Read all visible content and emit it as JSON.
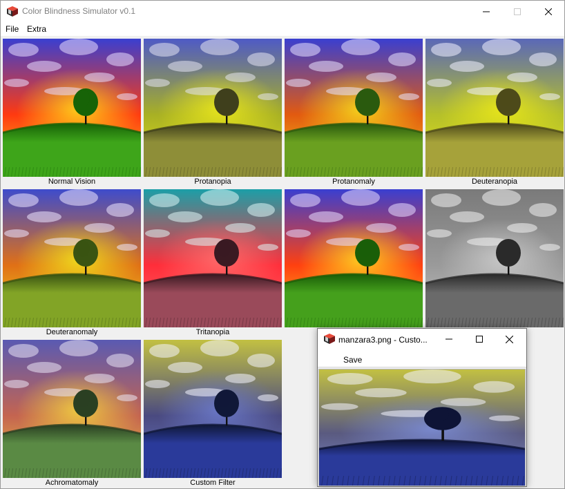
{
  "window": {
    "title": "Color Blindness Simulator v0.1",
    "icon": "app-cube-icon"
  },
  "menu": {
    "file": "File",
    "extra": "Extra"
  },
  "tiles": [
    {
      "label": "Normal Vision",
      "sky_top": "#3a3fd0",
      "sky_mid": "#ff3a10",
      "horizon": "#ffd21a",
      "grass": "#3ea51a",
      "grass_dark": "#176307",
      "cloud": "#e8ddff"
    },
    {
      "label": "Protanopia",
      "sky_top": "#4e5ac6",
      "sky_mid": "#a8b024",
      "horizon": "#e8e51c",
      "grass": "#8e8e38",
      "grass_dark": "#3f3f1c",
      "cloud": "#e4e4f0"
    },
    {
      "label": "Protanomaly",
      "sky_top": "#3a3fd0",
      "sky_mid": "#e25a10",
      "horizon": "#f5d51c",
      "grass": "#6aa020",
      "grass_dark": "#2a5a0e",
      "cloud": "#e8e2ff"
    },
    {
      "label": "Deuteranopia",
      "sky_top": "#5a68b8",
      "sky_mid": "#b5c02a",
      "horizon": "#e8e61a",
      "grass": "#a6a23a",
      "grass_dark": "#4d4a1a",
      "cloud": "#f0f0ff"
    },
    {
      "label": "Deuteranomaly",
      "sky_top": "#3e4ccc",
      "sky_mid": "#e07016",
      "horizon": "#f0dc1c",
      "grass": "#82a426",
      "grass_dark": "#3a5412",
      "cloud": "#ece6ff"
    },
    {
      "label": "Tritanopia",
      "sky_top": "#1c9fa8",
      "sky_mid": "#ff2e3a",
      "horizon": "#ff6a6a",
      "grass": "#9a4a5a",
      "grass_dark": "#3a1a22",
      "cloud": "#ddf5f5"
    },
    {
      "label": "",
      "sky_top": "#3a3fd0",
      "sky_mid": "#ff4010",
      "horizon": "#ffcf20",
      "grass": "#45a01c",
      "grass_dark": "#1a5e08",
      "cloud": "#e8ddff"
    },
    {
      "label": "",
      "sky_top": "#7a7a7a",
      "sky_mid": "#9a9a9a",
      "horizon": "#c8c8c8",
      "grass": "#6a6a6a",
      "grass_dark": "#2a2a2a",
      "cloud": "#f2f2f2"
    },
    {
      "label": "Achromatomaly",
      "sky_top": "#5a5ab2",
      "sky_mid": "#c46450",
      "horizon": "#f0cc40",
      "grass": "#5a8a44",
      "grass_dark": "#2a4022",
      "cloud": "#eae4f4"
    },
    {
      "label": "Custom Filter",
      "sky_top": "#c2c042",
      "sky_mid": "#4a4a80",
      "horizon": "#6a78c8",
      "grass": "#2a3a9a",
      "grass_dark": "#101838",
      "cloud": "#f4f4ff"
    }
  ],
  "custom_window": {
    "title": "manzara3.png - Custo...",
    "save": "Save",
    "image": {
      "sky_top": "#c2c042",
      "sky_mid": "#5a5a80",
      "horizon": "#7a8ad0",
      "grass": "#2a3a9a",
      "grass_dark": "#0e1436",
      "cloud": "#f4f4ff"
    }
  },
  "icons": [
    "minimize-icon",
    "maximize-icon",
    "close-icon"
  ]
}
